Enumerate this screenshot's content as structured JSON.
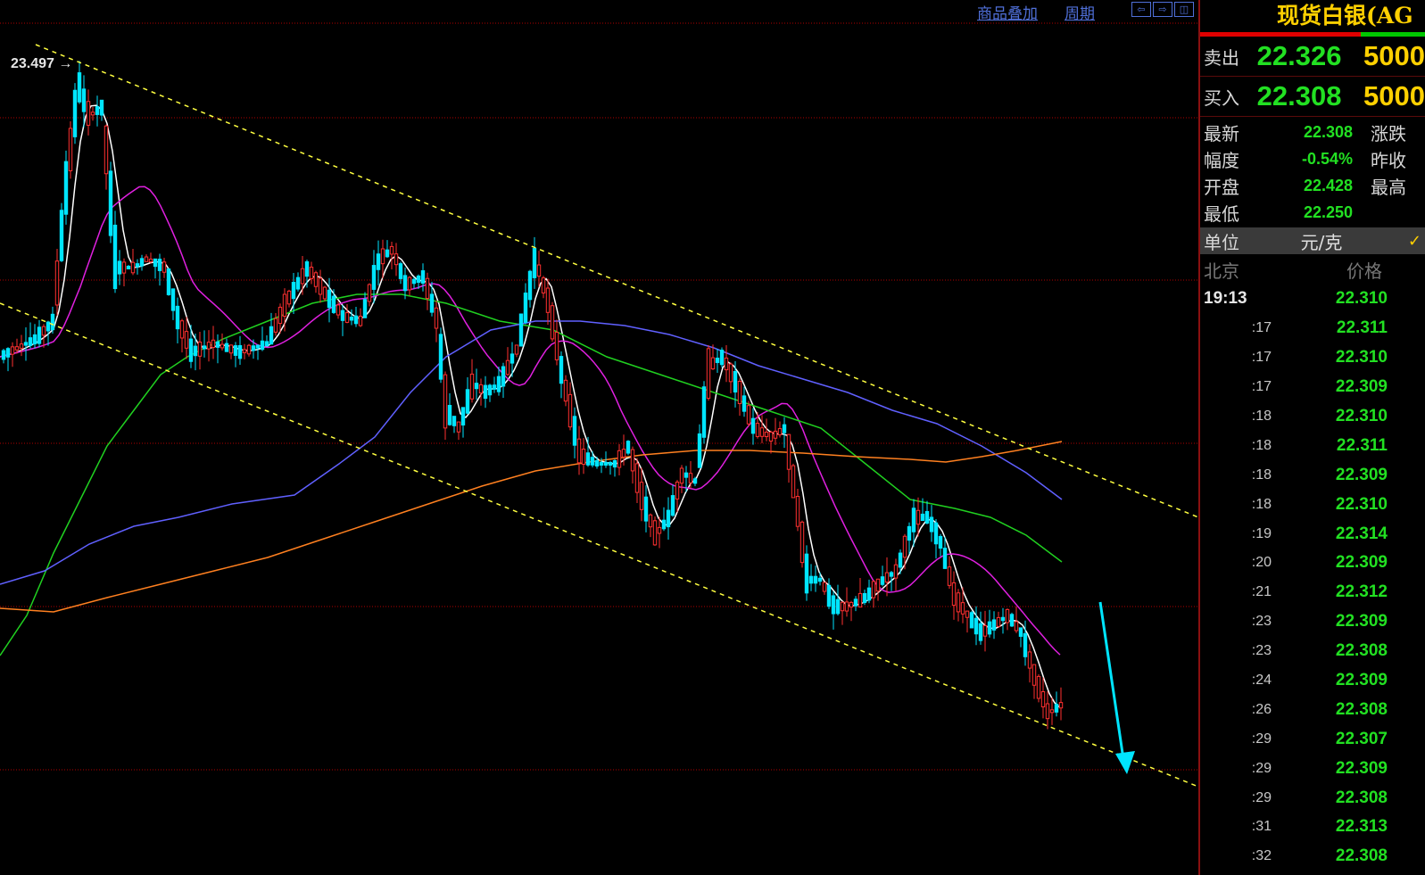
{
  "toolbar": {
    "overlay_label": "商品叠加",
    "period_label": "周期",
    "icons": [
      "arrow-left-icon",
      "arrow-right-icon",
      "panel-toggle-icon"
    ]
  },
  "chart": {
    "high_label": "23.497",
    "colors": {
      "up": "#ff3030",
      "down": "#00e5ff",
      "ma5": "#ffffff",
      "ma10": "#ffe000",
      "ma20": "#e020e0",
      "ma60": "#20d020",
      "ma120": "#6060ff",
      "ma250": "#ff8020",
      "channel": "#ffff40",
      "grid": "#b00000",
      "arrow": "#00e5ff"
    }
  },
  "quote": {
    "title": "现货白银(AG",
    "sell_label": "卖出",
    "sell_price": "22.326",
    "sell_vol": "5000",
    "buy_label": "买入",
    "buy_price": "22.308",
    "buy_vol": "5000"
  },
  "stats": [
    {
      "label": "最新",
      "value": "22.308",
      "label2": "涨跌"
    },
    {
      "label": "幅度",
      "value": "-0.54%",
      "label2": "昨收"
    },
    {
      "label": "开盘",
      "value": "22.428",
      "label2": "最高"
    },
    {
      "label": "最低",
      "value": "22.250",
      "label2": ""
    }
  ],
  "unit": {
    "label": "单位",
    "value": "元/克",
    "check": "✓"
  },
  "ticks_header": {
    "city": "北京",
    "price": "价格"
  },
  "ticks": [
    {
      "time": "19:13",
      "price": "22.310"
    },
    {
      "time": ":17",
      "price": "22.311"
    },
    {
      "time": ":17",
      "price": "22.310"
    },
    {
      "time": ":17",
      "price": "22.309"
    },
    {
      "time": ":18",
      "price": "22.310"
    },
    {
      "time": ":18",
      "price": "22.311"
    },
    {
      "time": ":18",
      "price": "22.309"
    },
    {
      "time": ":18",
      "price": "22.310"
    },
    {
      "time": ":19",
      "price": "22.314"
    },
    {
      "time": ":20",
      "price": "22.309"
    },
    {
      "time": ":21",
      "price": "22.312"
    },
    {
      "time": ":23",
      "price": "22.309"
    },
    {
      "time": ":23",
      "price": "22.308"
    },
    {
      "time": ":24",
      "price": "22.309"
    },
    {
      "time": ":26",
      "price": "22.308"
    },
    {
      "time": ":29",
      "price": "22.307"
    },
    {
      "time": ":29",
      "price": "22.309"
    },
    {
      "time": ":29",
      "price": "22.308"
    },
    {
      "time": ":31",
      "price": "22.313"
    },
    {
      "time": ":32",
      "price": "22.308"
    }
  ]
}
